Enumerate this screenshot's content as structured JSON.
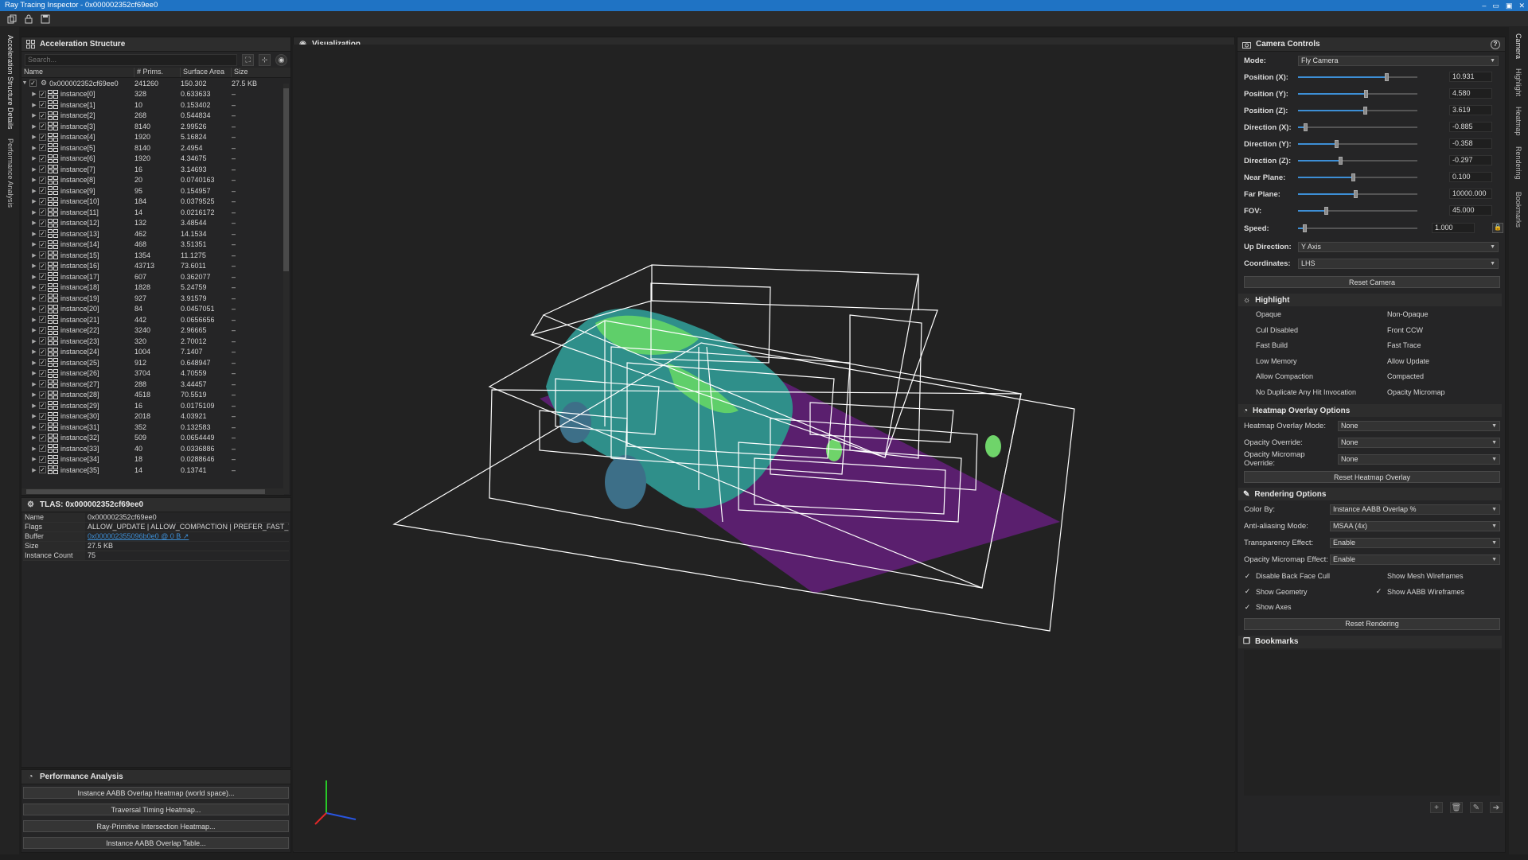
{
  "window": {
    "title": "Ray Tracing Inspector - 0x000002352cf69ee0"
  },
  "left_tabs": [
    "Acceleration Structure Details",
    "Performance Analysis"
  ],
  "right_tabs": [
    "Camera",
    "Highlight",
    "Heatmap",
    "Rendering",
    "Bookmarks"
  ],
  "accel": {
    "title": "Acceleration Structure",
    "search_placeholder": "Search...",
    "columns": [
      "Name",
      "# Prims.",
      "Surface Area",
      "Size"
    ],
    "root": {
      "name": "0x000002352cf69ee0",
      "prims": "241260",
      "area": "150.302",
      "size": "27.5 KB"
    },
    "rows": [
      [
        "instance[0]",
        "328",
        "0.633633",
        "–"
      ],
      [
        "instance[1]",
        "10",
        "0.153402",
        "–"
      ],
      [
        "instance[2]",
        "268",
        "0.544834",
        "–"
      ],
      [
        "instance[3]",
        "8140",
        "2.99526",
        "–"
      ],
      [
        "instance[4]",
        "1920",
        "5.16824",
        "–"
      ],
      [
        "instance[5]",
        "8140",
        "2.4954",
        "–"
      ],
      [
        "instance[6]",
        "1920",
        "4.34675",
        "–"
      ],
      [
        "instance[7]",
        "16",
        "3.14693",
        "–"
      ],
      [
        "instance[8]",
        "20",
        "0.0740163",
        "–"
      ],
      [
        "instance[9]",
        "95",
        "0.154957",
        "–"
      ],
      [
        "instance[10]",
        "184",
        "0.0379525",
        "–"
      ],
      [
        "instance[11]",
        "14",
        "0.0216172",
        "–"
      ],
      [
        "instance[12]",
        "132",
        "3.48544",
        "–"
      ],
      [
        "instance[13]",
        "462",
        "14.1534",
        "–"
      ],
      [
        "instance[14]",
        "468",
        "3.51351",
        "–"
      ],
      [
        "instance[15]",
        "1354",
        "11.1275",
        "–"
      ],
      [
        "instance[16]",
        "43713",
        "73.6011",
        "–"
      ],
      [
        "instance[17]",
        "607",
        "0.362077",
        "–"
      ],
      [
        "instance[18]",
        "1828",
        "5.24759",
        "–"
      ],
      [
        "instance[19]",
        "927",
        "3.91579",
        "–"
      ],
      [
        "instance[20]",
        "84",
        "0.0457051",
        "–"
      ],
      [
        "instance[21]",
        "442",
        "0.0656656",
        "–"
      ],
      [
        "instance[22]",
        "3240",
        "2.96665",
        "–"
      ],
      [
        "instance[23]",
        "320",
        "2.70012",
        "–"
      ],
      [
        "instance[24]",
        "1004",
        "7.1407",
        "–"
      ],
      [
        "instance[25]",
        "912",
        "0.648947",
        "–"
      ],
      [
        "instance[26]",
        "3704",
        "4.70559",
        "–"
      ],
      [
        "instance[27]",
        "288",
        "3.44457",
        "–"
      ],
      [
        "instance[28]",
        "4518",
        "70.5519",
        "–"
      ],
      [
        "instance[29]",
        "16",
        "0.0175109",
        "–"
      ],
      [
        "instance[30]",
        "2018",
        "4.03921",
        "–"
      ],
      [
        "instance[31]",
        "352",
        "0.132583",
        "–"
      ],
      [
        "instance[32]",
        "509",
        "0.0654449",
        "–"
      ],
      [
        "instance[33]",
        "40",
        "0.0336886",
        "–"
      ],
      [
        "instance[34]",
        "18",
        "0.0288646",
        "–"
      ],
      [
        "instance[35]",
        "14",
        "0.13741",
        "–"
      ]
    ]
  },
  "tlas": {
    "title": "TLAS: 0x000002352cf69ee0",
    "props": [
      {
        "k": "Name",
        "v": "0x000002352cf69ee0",
        "link": false
      },
      {
        "k": "Flags",
        "v": "ALLOW_UPDATE | ALLOW_COMPACTION | PREFER_FAST_TRA...",
        "link": false
      },
      {
        "k": "Buffer",
        "v": "0x000002355096b0e0 @ 0 B ↗",
        "link": true
      },
      {
        "k": "Size",
        "v": "27.5 KB",
        "link": false
      },
      {
        "k": "Instance Count",
        "v": "75",
        "link": false
      }
    ]
  },
  "perf": {
    "title": "Performance Analysis",
    "buttons": [
      "Instance AABB Overlap Heatmap (world space)...",
      "Traversal Timing Heatmap...",
      "Ray-Primitive Intersection Heatmap...",
      "Instance AABB Overlap Table..."
    ]
  },
  "viz": {
    "title": "Visualization"
  },
  "camera": {
    "title": "Camera Controls",
    "mode_label": "Mode:",
    "mode_value": "Fly Camera",
    "sliders": [
      {
        "label": "Position (X):",
        "value": "10.931",
        "level": 0.74
      },
      {
        "label": "Position (Y):",
        "value": "4.580",
        "level": 0.57
      },
      {
        "label": "Position (Z):",
        "value": "3.619",
        "level": 0.56
      },
      {
        "label": "Direction (X):",
        "value": "-0.885",
        "level": 0.06
      },
      {
        "label": "Direction (Y):",
        "value": "-0.358",
        "level": 0.32
      },
      {
        "label": "Direction (Z):",
        "value": "-0.297",
        "level": 0.35
      },
      {
        "label": "Near Plane:",
        "value": "0.100",
        "level": 0.46
      },
      {
        "label": "Far Plane:",
        "value": "10000.000",
        "level": 0.48
      },
      {
        "label": "FOV:",
        "value": "45.000",
        "level": 0.23
      }
    ],
    "speed_label": "Speed:",
    "speed_value": "1.000",
    "speed_level": 0.04,
    "up_label": "Up Direction:",
    "up_value": "Y Axis",
    "coord_label": "Coordinates:",
    "coord_value": "LHS",
    "reset": "Reset Camera"
  },
  "highlight": {
    "title": "Highlight",
    "items": [
      "Opaque",
      "Non-Opaque",
      "Cull Disabled",
      "Front CCW",
      "Fast Build",
      "Fast Trace",
      "Low Memory",
      "Allow Update",
      "Allow Compaction",
      "Compacted",
      "No Duplicate Any Hit Invocation",
      "Opacity Micromap"
    ]
  },
  "heatmap": {
    "title": "Heatmap Overlay Options",
    "rows": [
      {
        "label": "Heatmap Overlay Mode:",
        "value": "None"
      },
      {
        "label": "Opacity Override:",
        "value": "None"
      },
      {
        "label": "Opacity Micromap Override:",
        "value": "None"
      }
    ],
    "reset": "Reset Heatmap Overlay"
  },
  "rendering": {
    "title": "Rendering Options",
    "rows": [
      {
        "label": "Color By:",
        "value": "Instance AABB Overlap %"
      },
      {
        "label": "Anti-aliasing Mode:",
        "value": "MSAA (4x)"
      },
      {
        "label": "Transparency Effect:",
        "value": "Enable"
      },
      {
        "label": "Opacity Micromap Effect:",
        "value": "Enable"
      }
    ],
    "checks": [
      {
        "label": "Disable Back Face Cull",
        "checked": true
      },
      {
        "label": "Show Mesh Wireframes",
        "checked": false
      },
      {
        "label": "Show Geometry",
        "checked": true
      },
      {
        "label": "Show AABB Wireframes",
        "checked": true
      },
      {
        "label": "Show Axes",
        "checked": true
      }
    ],
    "reset": "Reset Rendering"
  },
  "bookmarks": {
    "title": "Bookmarks"
  },
  "colors": {
    "accent": "#1f73c4",
    "ground": "#5a1f6e",
    "mesh_teal": "#2f8f8a",
    "mesh_green": "#5fcf6a"
  }
}
